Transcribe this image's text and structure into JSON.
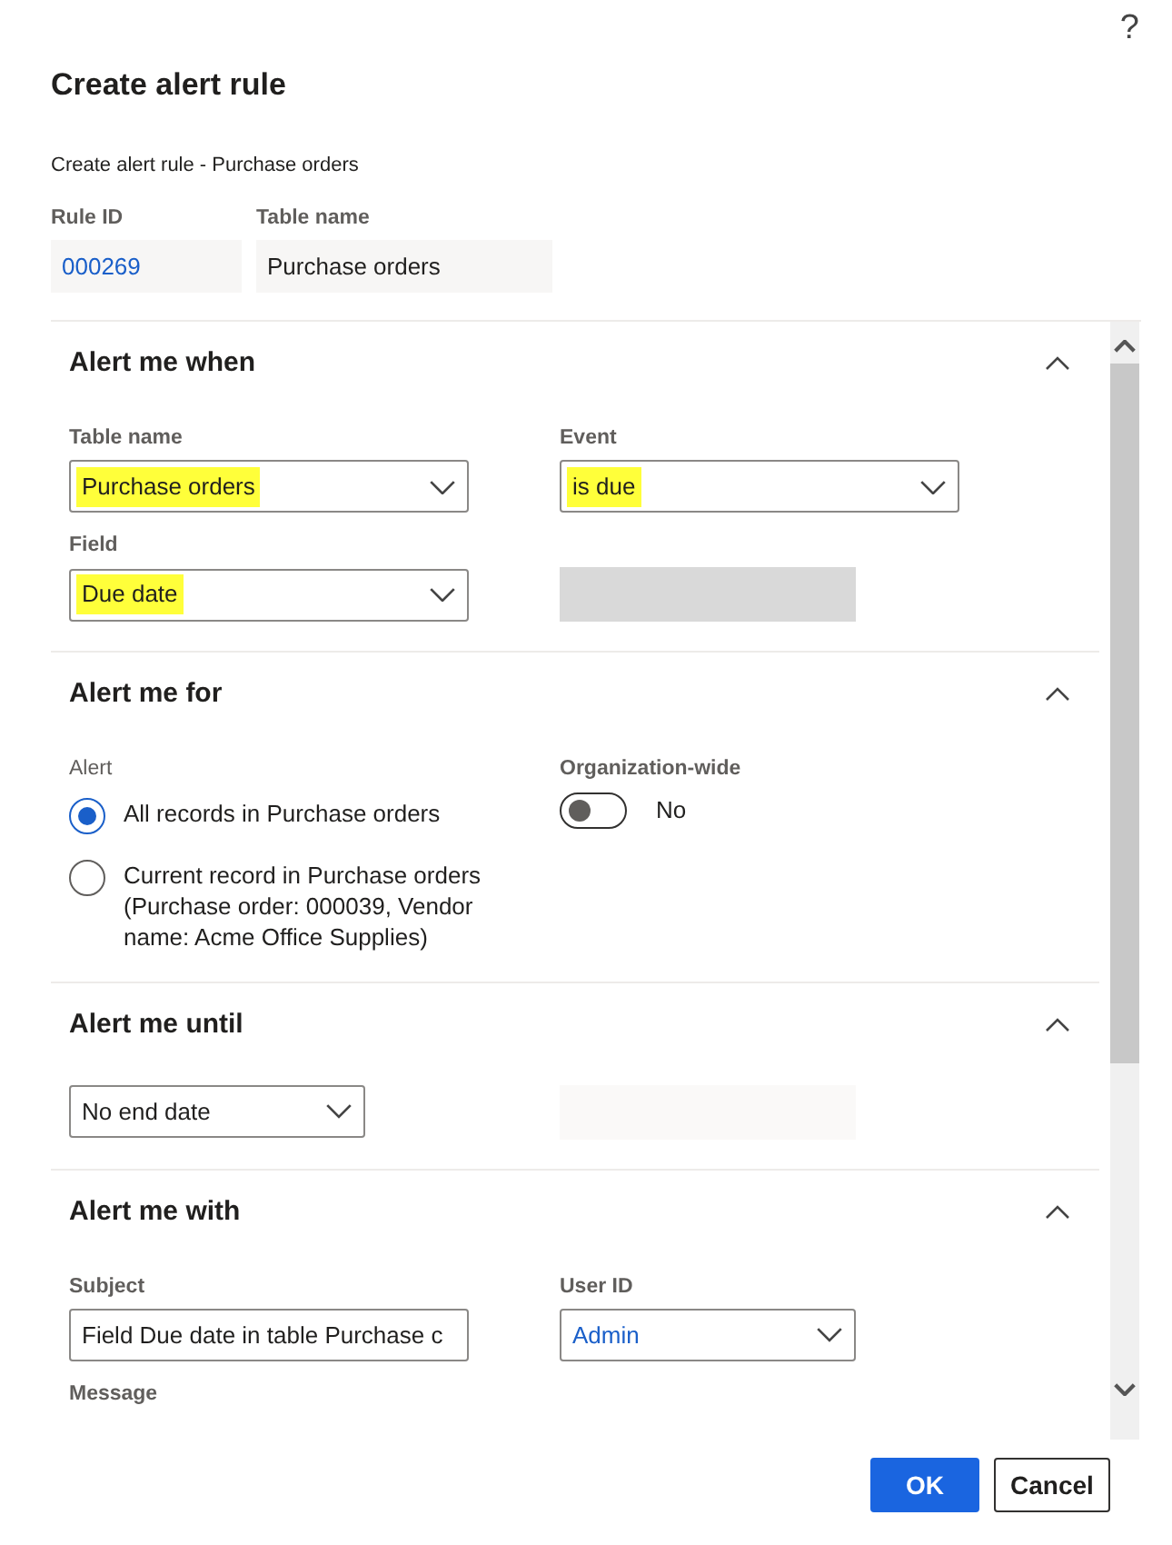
{
  "help": "?",
  "title": "Create alert rule",
  "subtitle": "Create alert rule - Purchase orders",
  "header_fields": [
    {
      "label": "Rule ID",
      "value": "000269",
      "link": true
    },
    {
      "label": "Table name",
      "value": "Purchase orders",
      "link": false
    }
  ],
  "sections": [
    {
      "title": "Alert me when",
      "expanded": true,
      "fields": [
        {
          "kind": "dropdown",
          "label": "Table name",
          "value": "Purchase orders",
          "highlighted": true,
          "link": false
        },
        {
          "kind": "dropdown",
          "label": "Event",
          "value": "is due",
          "highlighted": true,
          "link": false
        },
        {
          "kind": "dropdown",
          "label": "Field",
          "value": "Due date",
          "highlighted": true,
          "link": false
        },
        {
          "kind": "empty",
          "disabled": true
        }
      ]
    },
    {
      "title": "Alert me for",
      "expanded": true,
      "fields": [
        {
          "kind": "radio",
          "label": "Alert",
          "options": [
            {
              "label": "All records in Purchase orders",
              "selected": true
            },
            {
              "label": "Current record in Purchase orders (Purchase order: 000039, Vendor name: Acme Office Supplies)",
              "selected": false
            }
          ]
        },
        {
          "kind": "toggle",
          "label": "Organization-wide",
          "on": false,
          "text": "No"
        }
      ]
    },
    {
      "title": "Alert me until",
      "expanded": true,
      "fields": [
        {
          "kind": "dropdown",
          "value": "No end date",
          "highlighted": false,
          "link": false,
          "short": true
        },
        {
          "kind": "empty",
          "disabled": false
        }
      ]
    },
    {
      "title": "Alert me with",
      "expanded": true,
      "fields": [
        {
          "kind": "textbox",
          "label": "Subject",
          "value": "Field Due date in table Purchase c"
        },
        {
          "kind": "dropdown",
          "label": "User ID",
          "value": "Admin",
          "highlighted": false,
          "link": true,
          "short": true
        },
        {
          "kind": "label",
          "label": "Message"
        }
      ]
    }
  ],
  "buttons": [
    {
      "label": "OK",
      "primary": true
    },
    {
      "label": "Cancel",
      "primary": false
    }
  ]
}
